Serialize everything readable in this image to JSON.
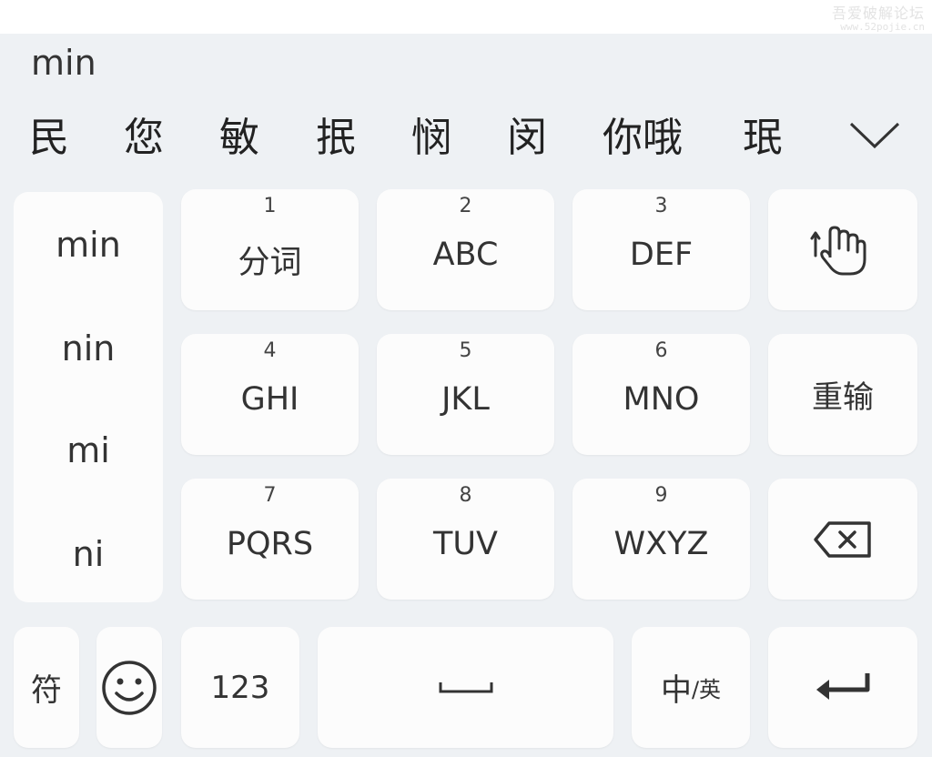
{
  "watermark": {
    "line1": "吾爱破解论坛",
    "line2": "www.52pojie.cn"
  },
  "composing_text": "min",
  "candidates": [
    "民",
    "您",
    "敏",
    "抿",
    "悯",
    "闵",
    "你哦",
    "珉"
  ],
  "pinyin_options": [
    "min",
    "nin",
    "mi",
    "ni"
  ],
  "keys": {
    "k1": {
      "num": "1",
      "label": "分词"
    },
    "k2": {
      "num": "2",
      "label": "ABC"
    },
    "k3": {
      "num": "3",
      "label": "DEF"
    },
    "k4": {
      "num": "4",
      "label": "GHI"
    },
    "k5": {
      "num": "5",
      "label": "JKL"
    },
    "k6": {
      "num": "6",
      "label": "MNO"
    },
    "k7": {
      "num": "7",
      "label": "PQRS"
    },
    "k8": {
      "num": "8",
      "label": "TUV"
    },
    "k9": {
      "num": "9",
      "label": "WXYZ"
    }
  },
  "reinput_label": "重输",
  "symbol_label": "符",
  "numeric_label": "123",
  "lang_switch": {
    "primary": "中",
    "secondary": "/英"
  },
  "icons": {
    "expand": "chevron-down-icon",
    "gesture": "hand-swipe-icon",
    "backspace": "backspace-icon",
    "emoji": "smiley-icon",
    "space": "space-bar-icon",
    "enter": "enter-arrow-icon"
  },
  "colors": {
    "background": "#eef1f4",
    "key": "#fcfcfc",
    "text": "#333333"
  }
}
